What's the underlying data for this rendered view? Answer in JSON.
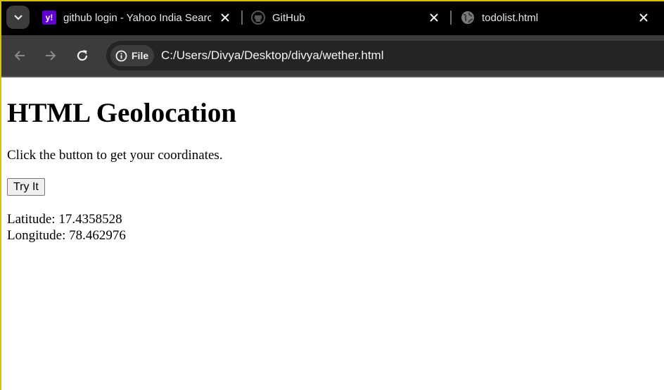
{
  "browser": {
    "tabs": [
      {
        "title": "github login - Yahoo India Search",
        "favicon": "yahoo-icon",
        "favicon_text": "y!",
        "favicon_color": "#6001d2"
      },
      {
        "title": "GitHub",
        "favicon": "github-icon"
      },
      {
        "title": "todolist.html",
        "favicon": "globe-icon"
      }
    ],
    "security_chip": "File",
    "url": "C:/Users/Divya/Desktop/divya/wether.html"
  },
  "page": {
    "heading": "HTML Geolocation",
    "instruction": "Click the button to get your coordinates.",
    "button_label": "Try It",
    "latitude_text": "Latitude: 17.4358528",
    "longitude_text": "Longitude: 78.462976"
  },
  "colors": {
    "tabbar_bg": "#000000",
    "toolbar_bg": "#3c3c3c",
    "omnibox_bg": "#242424",
    "window_border": "#d9c100"
  }
}
